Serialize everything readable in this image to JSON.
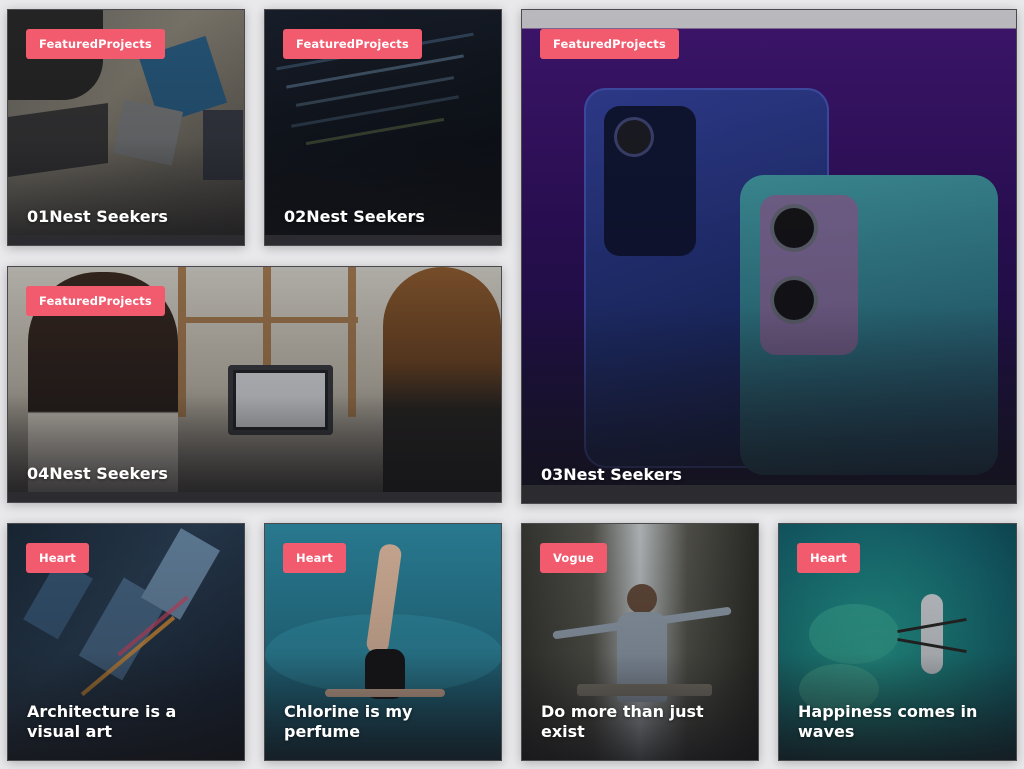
{
  "cards": [
    {
      "badge": "FeaturedProjects",
      "title": "01Nest Seekers"
    },
    {
      "badge": "FeaturedProjects",
      "title": "02Nest Seekers"
    },
    {
      "badge": "FeaturedProjects",
      "title": "03Nest Seekers"
    },
    {
      "badge": "FeaturedProjects",
      "title": "04Nest Seekers"
    },
    {
      "badge": "Heart",
      "title": "Architecture is a visual art"
    },
    {
      "badge": "Heart",
      "title": "Chlorine is my perfume"
    },
    {
      "badge": "Vogue",
      "title": "Do more than just exist"
    },
    {
      "badge": "Heart",
      "title": "Happiness comes in waves"
    }
  ],
  "colors": {
    "badge": "#f25a6e",
    "page_background": "#e9e9ec"
  }
}
